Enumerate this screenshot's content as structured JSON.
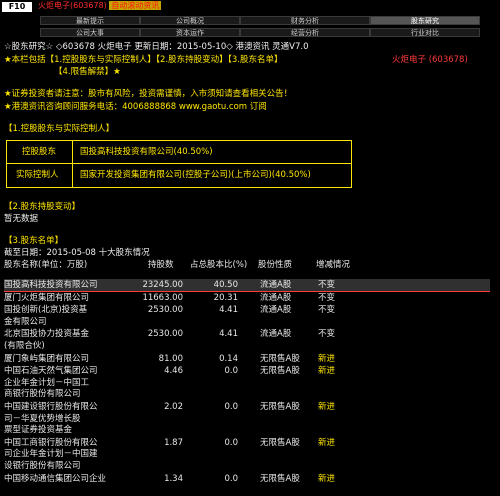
{
  "topbar": {
    "f_button": "F10",
    "ticker": "火炬电子(603678)",
    "ticker_tag": "自动滚动资讯"
  },
  "tabs": [
    [
      "最新提示",
      "公司概况",
      "财务分析",
      "股东研究"
    ],
    [
      "公司大事",
      "资本运作",
      "经营分析",
      "行业对比"
    ]
  ],
  "header": {
    "line1": "☆股东研究☆ ◇603678 火炬电子 更新日期：2015-05-10◇ 港澳资讯 灵通V7.0",
    "line2": "★本栏包括【1.控股股东与实际控制人】【2.股东持股变动】【3.股东名单】",
    "line3": "【4.限售解禁】★",
    "stock_label": "火炬电子 (603678)"
  },
  "notice": {
    "line1": "★证券投资者请注意：股市有风险，投资需谨慎，入市须知请查看相关公告！",
    "line2": "★港澳资讯咨询顾问服务电话：4006888868 www.gaotu.com 订阅"
  },
  "section1": {
    "title": "【1.控股股东与实际控制人】",
    "row1_label": "控股股东",
    "row1_value": "国投高科技投资有限公司(40.50%)",
    "row2_label": "实际控制人",
    "row2_value": "国家开发投资集团有限公司(控股子公司)(上市公司)(40.50%)"
  },
  "section2": {
    "title": "【2.股东持股变动】",
    "body": "暂无数据"
  },
  "section3": {
    "title": "【3.股东名单】",
    "subtitle": "截至日期：2015-05-08 十大股东情况",
    "columns": [
      "股东名称(单位：万股)",
      "持股数",
      "占总股本比(%)",
      "股份性质",
      "增减情况"
    ],
    "rows": [
      {
        "name": [
          "国投高科技投资有限公司"
        ],
        "shares": "23245.00",
        "pct": "40.50",
        "nature": "流通A股",
        "change": "不变"
      },
      {
        "name": [
          "厦门火炬集团有限公司"
        ],
        "shares": "11663.00",
        "pct": "20.31",
        "nature": "流通A股",
        "change": "不变"
      },
      {
        "name": [
          "国投创新(北京)投资基",
          "金有限公司"
        ],
        "shares": "2530.00",
        "pct": "4.41",
        "nature": "流通A股",
        "change": "不变"
      },
      {
        "name": [
          "北京国投协力投资基金",
          "(有限合伙)"
        ],
        "shares": "2530.00",
        "pct": "4.41",
        "nature": "流通A股",
        "change": "不变"
      },
      {
        "name": [
          "厦门象屿集团有限公司"
        ],
        "shares": "81.00",
        "pct": "0.14",
        "nature": "无限售A股",
        "change": "新进"
      },
      {
        "name": [
          "中国石油天然气集团公司",
          "企业年金计划－中国工",
          "商银行股份有限公司"
        ],
        "shares": "4.46",
        "pct": "0.0",
        "nature": "无限售A股",
        "change": "新进"
      },
      {
        "name": [
          "中国建设银行股份有限公",
          "司－华夏优势增长股",
          "票型证券投资基金"
        ],
        "shares": "2.02",
        "pct": "0.0",
        "nature": "无限售A股",
        "change": "新进"
      },
      {
        "name": [
          "中国工商银行股份有限公",
          "司企业年金计划－中国建",
          "设银行股份有限公司"
        ],
        "shares": "1.87",
        "pct": "0.0",
        "nature": "无限售A股",
        "change": "新进"
      },
      {
        "name": [
          "中国移动通信集团公司企业"
        ],
        "shares": "1.34",
        "pct": "0.0",
        "nature": "无限售A股",
        "change": "新进"
      }
    ]
  }
}
